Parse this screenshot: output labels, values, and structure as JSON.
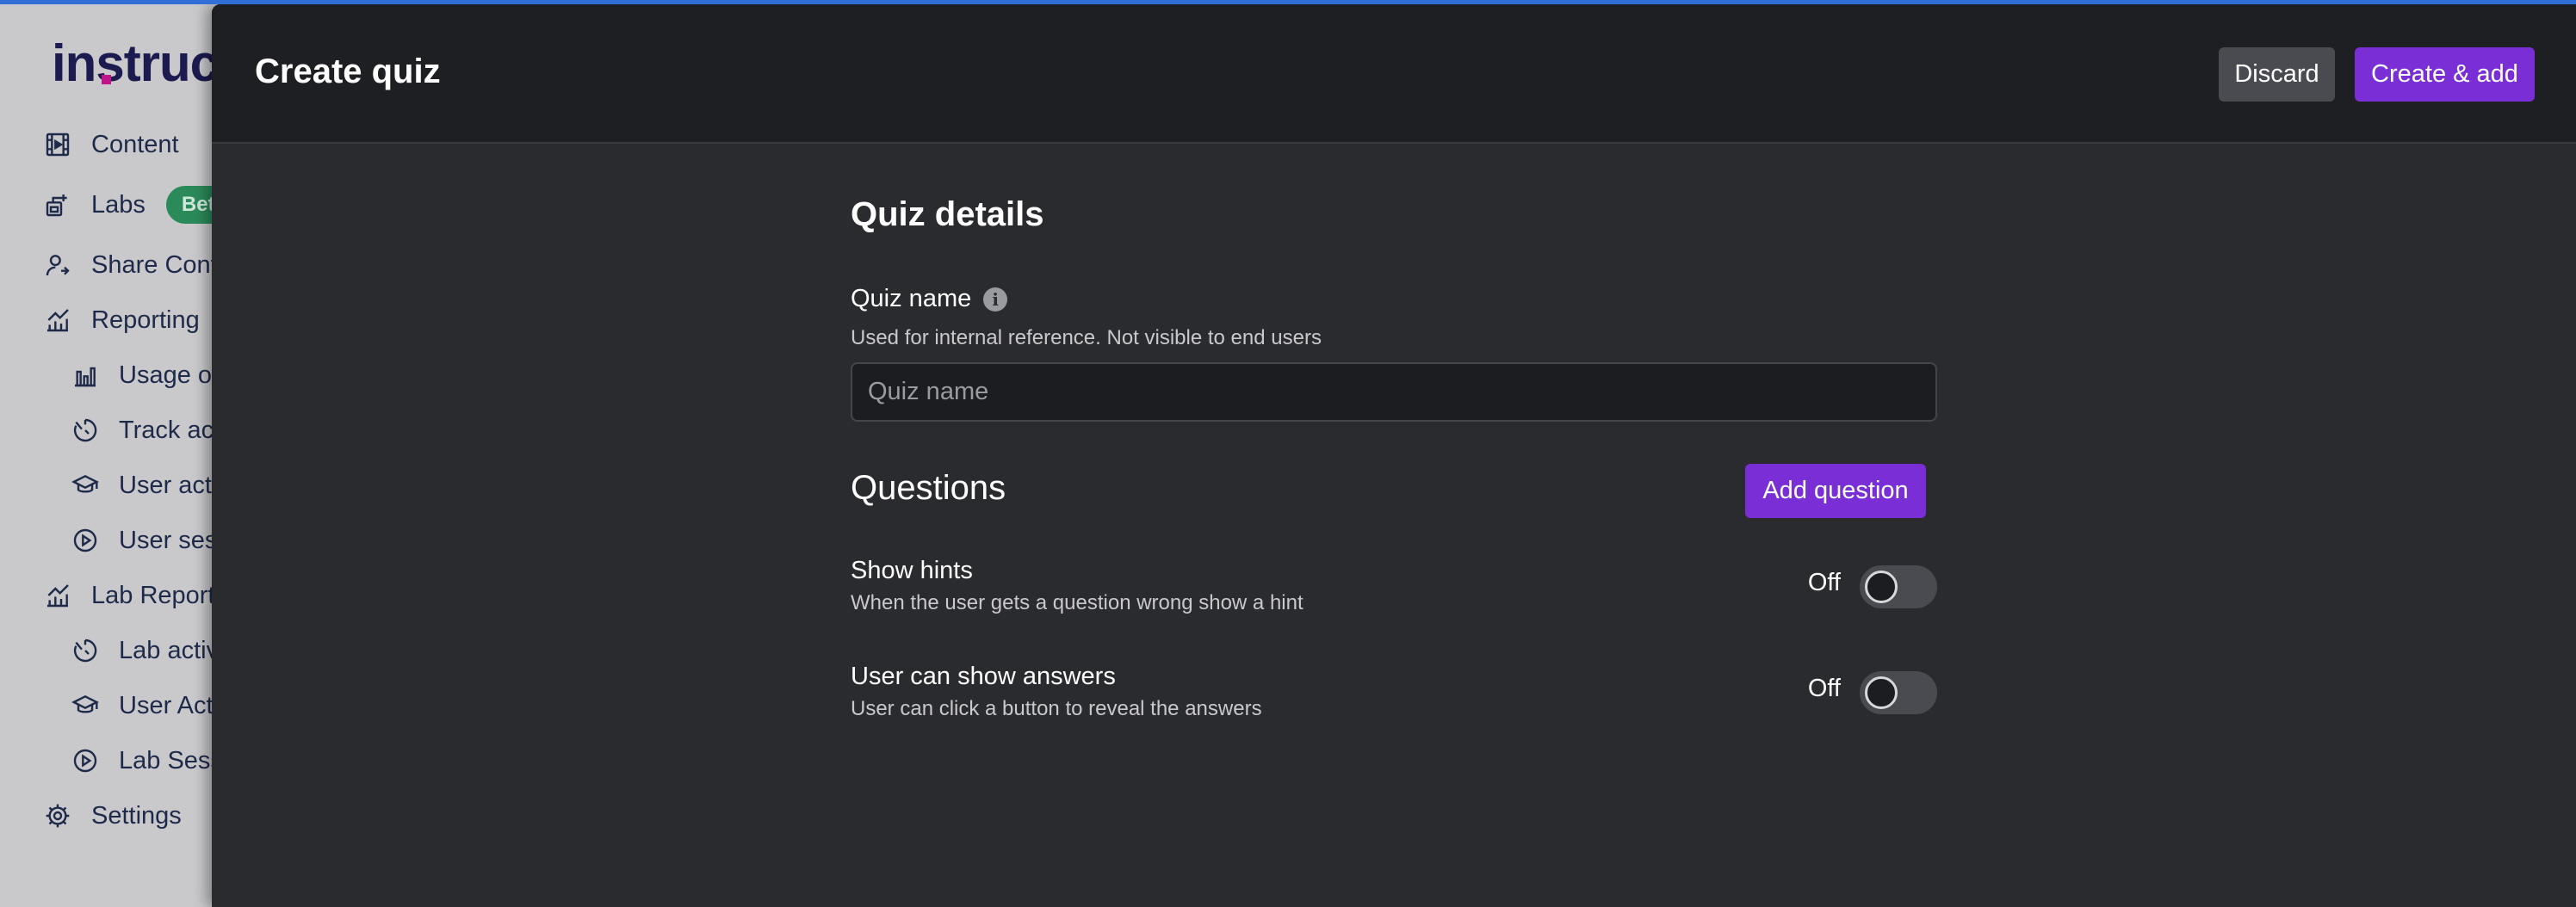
{
  "brand": {
    "logo_text": "instruc",
    "accent_color": "#7a2fd6",
    "topline_color": "#2f6fd6"
  },
  "sidebar": {
    "items": [
      {
        "label": "Content",
        "icon": "film-icon",
        "sub": false
      },
      {
        "label": "Labs",
        "icon": "labs-icon",
        "sub": false,
        "badge": "Beta"
      },
      {
        "label": "Share Content",
        "icon": "user-share-icon",
        "sub": false
      },
      {
        "label": "Reporting",
        "icon": "chart-icon",
        "sub": false
      },
      {
        "label": "Usage overview",
        "icon": "bar-chart-icon",
        "sub": true
      },
      {
        "label": "Track activity",
        "icon": "timer-icon",
        "sub": true
      },
      {
        "label": "User activity",
        "icon": "graduation-cap-icon",
        "sub": true
      },
      {
        "label": "User sessions",
        "icon": "play-circle-icon",
        "sub": true
      },
      {
        "label": "Lab Reporting",
        "icon": "chart-icon",
        "sub": false
      },
      {
        "label": "Lab activity",
        "icon": "timer-icon",
        "sub": true
      },
      {
        "label": "User Activity",
        "icon": "graduation-cap-icon",
        "sub": true
      },
      {
        "label": "Lab Sessions",
        "icon": "play-circle-icon",
        "sub": true
      },
      {
        "label": "Settings",
        "icon": "gear-icon",
        "sub": false
      }
    ]
  },
  "modal": {
    "title": "Create quiz",
    "discard_label": "Discard",
    "create_label": "Create & add",
    "details_title": "Quiz details",
    "quiz_name": {
      "label": "Quiz name",
      "help": "Used for internal reference. Not visible to end users",
      "placeholder": "Quiz name",
      "value": ""
    },
    "questions_title": "Questions",
    "add_question_label": "Add question",
    "toggles": [
      {
        "label": "Show hints",
        "description": "When the user gets a question wrong show a hint",
        "state": "Off"
      },
      {
        "label": "User can show answers",
        "description": "User can click a button to reveal the answers",
        "state": "Off"
      }
    ]
  }
}
